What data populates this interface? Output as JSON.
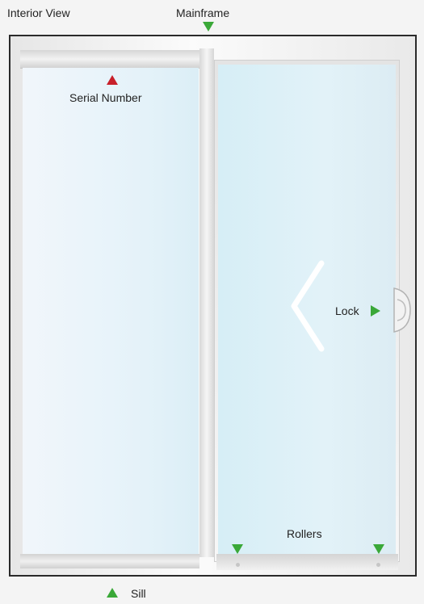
{
  "labels": {
    "view": "Interior View",
    "mainframe": "Mainframe",
    "serial_number": "Serial Number",
    "lock": "Lock",
    "rollers": "Rollers",
    "sill": "Sill"
  },
  "colors": {
    "marker_green": "#3aa838",
    "marker_red": "#c8202a",
    "frame_border": "#2a2a2a"
  },
  "icons": [
    "triangle-down-icon",
    "triangle-up-icon",
    "triangle-right-icon",
    "chevron-left-icon"
  ]
}
